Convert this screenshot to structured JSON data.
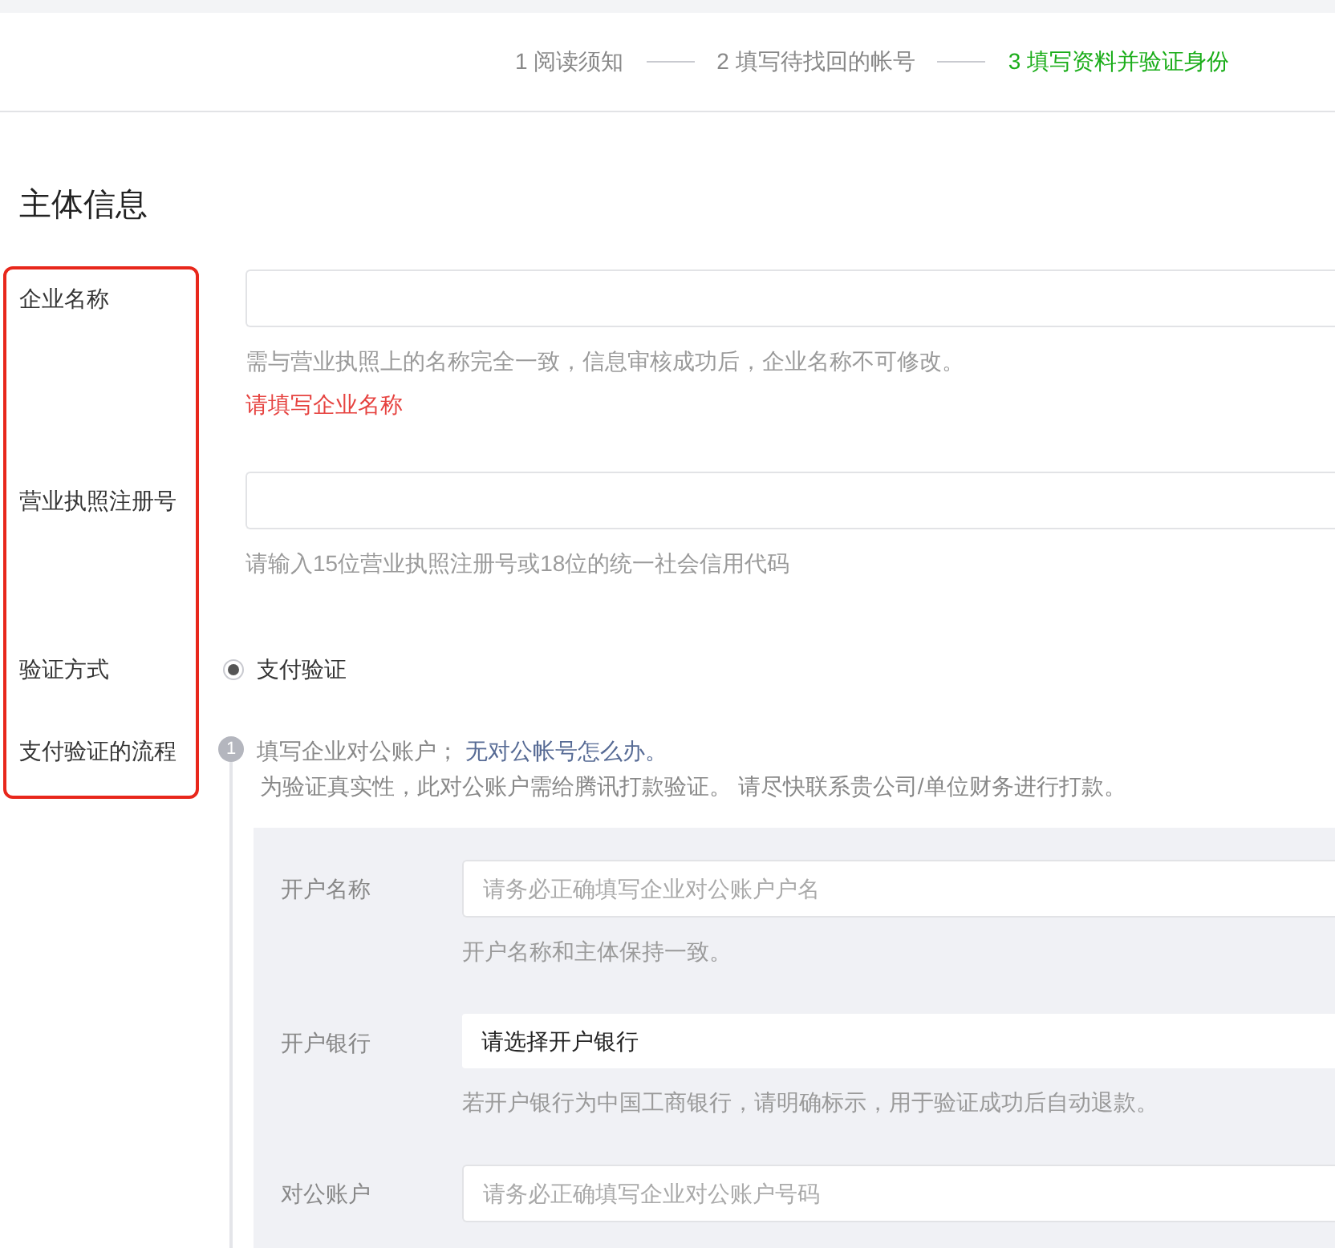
{
  "steps": [
    {
      "label": "1 阅读须知",
      "selected": false
    },
    {
      "label": "2 填写待找回的帐号",
      "selected": false
    },
    {
      "label": "3 填写资料并验证身份",
      "selected": true
    }
  ],
  "section_title": "主体信息",
  "fields": [
    {
      "label": "企业名称",
      "hint": "需与营业执照上的名称完全一致，信息审核成功后，企业名称不可修改。",
      "error": "请填写企业名称"
    },
    {
      "label": "营业执照注册号",
      "hint": "请输入15位营业执照注册号或18位的统一社会信用代码"
    }
  ],
  "verify_method": {
    "label": "验证方式",
    "options": [
      {
        "label": "支付验证",
        "selected": true
      }
    ]
  },
  "flow": {
    "label": "支付验证的流程",
    "step_number": "1",
    "text": "填写企业对公账户；",
    "link": "无对公帐号怎么办。",
    "note": "为验证真实性，此对公账户需给腾讯打款验证。 请尽快联系贵公司/单位财务进行打款。",
    "account_fields": [
      {
        "kind": "input",
        "label": "开户名称",
        "placeholder": "请务必正确填写企业对公账户户名",
        "hint": "开户名称和主体保持一致。"
      },
      {
        "kind": "select",
        "label": "开户银行",
        "value": "请选择开户银行",
        "hint": "若开户银行为中国工商银行，请明确标示，用于验证成功后自动退款。"
      },
      {
        "kind": "input",
        "label": "对公账户",
        "placeholder": "请务必正确填写企业对公账户号码"
      }
    ]
  }
}
